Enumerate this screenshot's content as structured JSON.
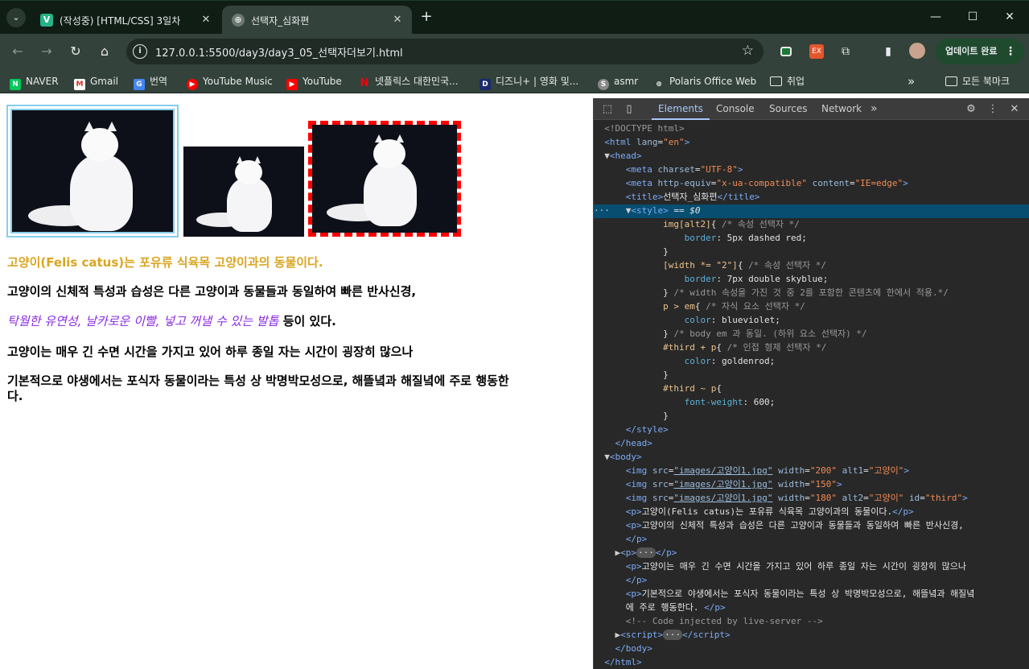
{
  "browser": {
    "tabs": [
      {
        "favicon": "V",
        "title": "(작성중) [HTML/CSS] 3일차",
        "active": false
      },
      {
        "favicon": "⊕",
        "title": "선택자_심화편",
        "active": true
      }
    ],
    "new_tab": "+",
    "window_controls": {
      "minimize": "—",
      "maximize": "☐",
      "close": "✕"
    },
    "address": "127.0.0.1:5500/day3/day3_05_선택자더보기.html",
    "update_button": "업데이트 완료",
    "bookmarks": [
      "NAVER",
      "Gmail",
      "번역",
      "YouTube Music",
      "YouTube",
      "넷플릭스 대한민국...",
      "디즈니+ | 영화 및...",
      "asmr",
      "Polaris Office Web",
      "취업"
    ],
    "all_bookmarks": "모든 북마크",
    "more": "»"
  },
  "page": {
    "images": [
      {
        "alt": "고양이",
        "border": "5px double skyblue"
      },
      {
        "alt": "",
        "border": "none"
      },
      {
        "alt": "고양이",
        "border": "5px dashed red"
      }
    ],
    "paragraphs": {
      "p1": "고양이(Felis catus)는 포유류 식육목 고양이과의 동물이다.",
      "p2": "고양이의 신체적 특성과 습성은 다른 고양이과 동물들과 동일하여 빠른 반사신경,",
      "p3_em": "탁월한 유연성, 날카로운 이빨, 넣고 꺼낼 수 있는 발톱",
      "p3_rest": " 등이 있다.",
      "p4": "고양이는 매우 긴 수면 시간을 가지고 있어 하루 종일 자는 시간이 굉장히 많으나",
      "p5a": "기본적으로 야생에서는 포식자 동물이라는 특성 상 박명박모성으로, 해뜰녘과 해질녘에 주로 행동한",
      "p5b": "다."
    },
    "colors": {
      "goldenrod": "#daa520",
      "blueviolet": "#8a2be2"
    }
  },
  "devtools": {
    "tabs": [
      "Elements",
      "Console",
      "Sources",
      "Network"
    ],
    "active_tab": "Elements",
    "more_tabs": "»"
  }
}
